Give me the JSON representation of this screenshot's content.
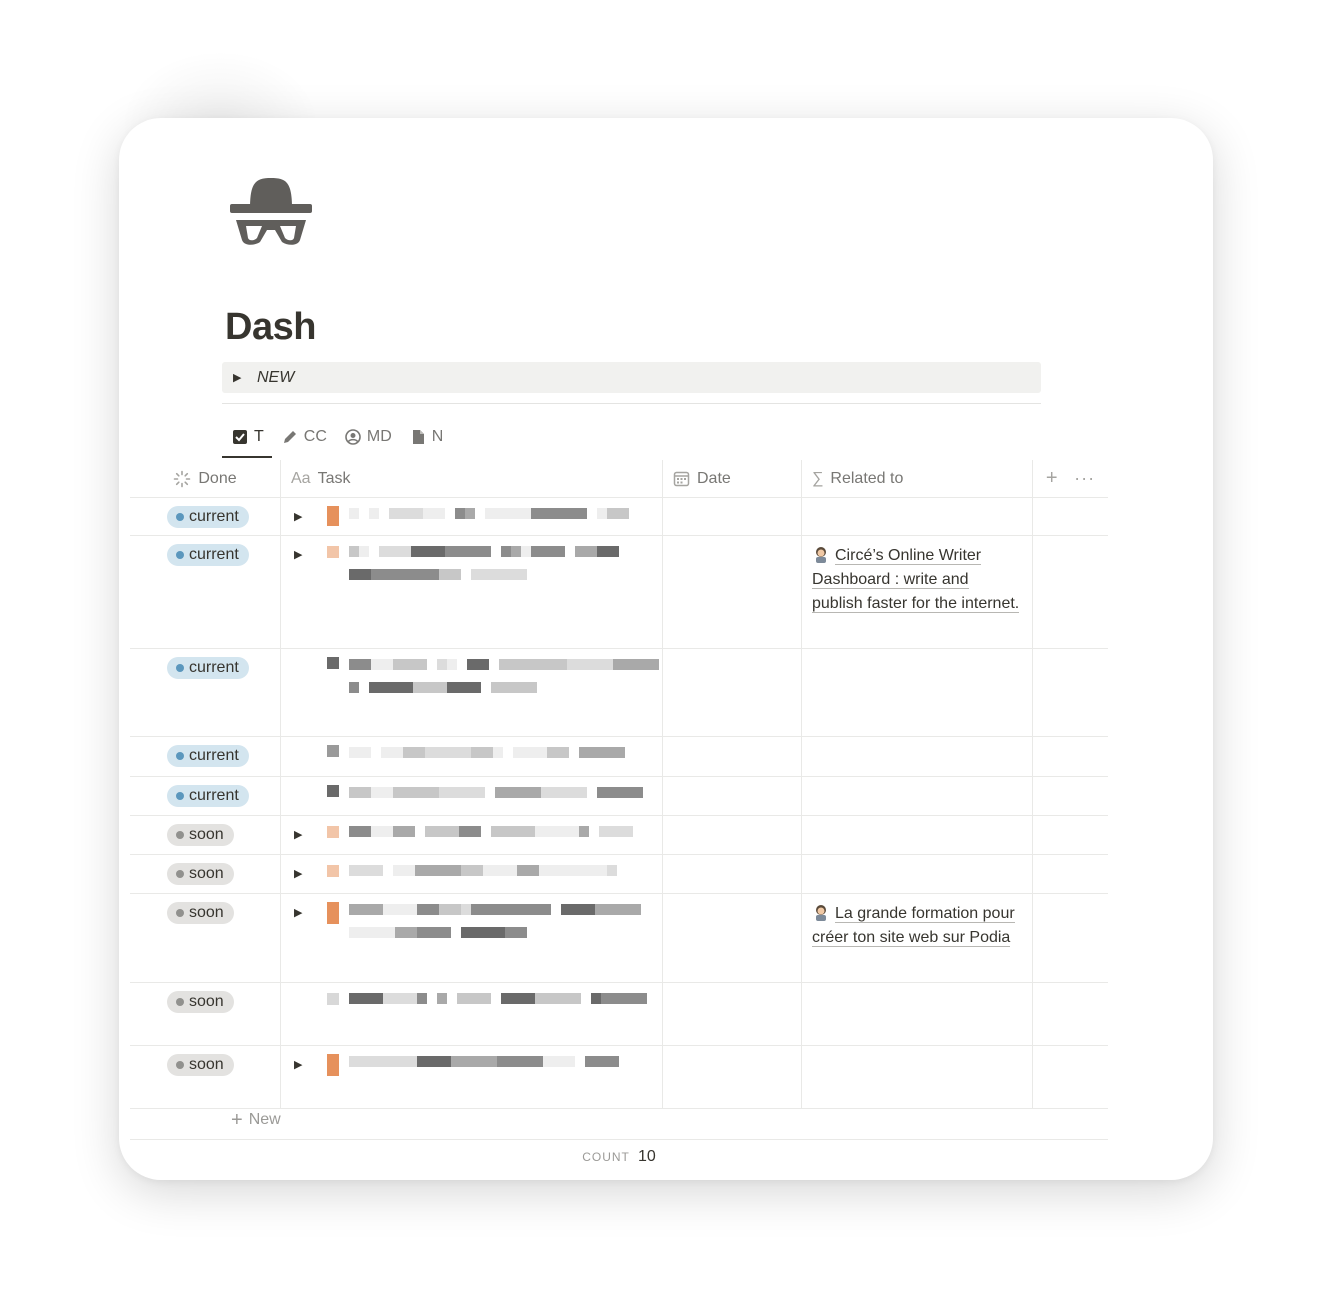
{
  "page": {
    "title": "Dash",
    "icon": "detective-icon",
    "toggle_label": "NEW"
  },
  "tabs": [
    {
      "label": "T",
      "icon": "checkbox-icon",
      "active": true
    },
    {
      "label": "CC",
      "icon": "pencil-icon",
      "active": false
    },
    {
      "label": "MD",
      "icon": "user-circle-icon",
      "active": false
    },
    {
      "label": "N",
      "icon": "document-icon",
      "active": false
    }
  ],
  "table": {
    "columns": [
      {
        "label": "Done",
        "icon": "status-icon"
      },
      {
        "label": "Task",
        "icon": "text-property-icon",
        "icon_text": "Aa"
      },
      {
        "label": "Date",
        "icon": "calendar-icon"
      },
      {
        "label": "Related to",
        "icon": "sigma-icon",
        "icon_text": "∑"
      }
    ],
    "add_column_icon": "plus-icon",
    "more_icon": "ellipsis-icon",
    "rows": [
      {
        "status": "current",
        "status_color": "#d3e5ef",
        "expandable": true,
        "related": ""
      },
      {
        "status": "current",
        "status_color": "#d3e5ef",
        "expandable": true,
        "related": "Circé’s Online Writer Dashboard : write and publish faster for the internet."
      },
      {
        "status": "current",
        "status_color": "#d3e5ef",
        "expandable": false,
        "related": ""
      },
      {
        "status": "current",
        "status_color": "#d3e5ef",
        "expandable": false,
        "related": ""
      },
      {
        "status": "current",
        "status_color": "#d3e5ef",
        "expandable": false,
        "related": ""
      },
      {
        "status": "soon",
        "status_color": "#e3e2e0",
        "expandable": true,
        "related": ""
      },
      {
        "status": "soon",
        "status_color": "#e3e2e0",
        "expandable": true,
        "related": ""
      },
      {
        "status": "soon",
        "status_color": "#e3e2e0",
        "expandable": true,
        "related": "La grande formation pour créer ton site web sur Podia"
      },
      {
        "status": "soon",
        "status_color": "#e3e2e0",
        "expandable": false,
        "related": ""
      },
      {
        "status": "soon",
        "status_color": "#e3e2e0",
        "expandable": true,
        "related": ""
      }
    ],
    "new_label": "New",
    "count_label": "COUNT",
    "count_value": "10"
  }
}
